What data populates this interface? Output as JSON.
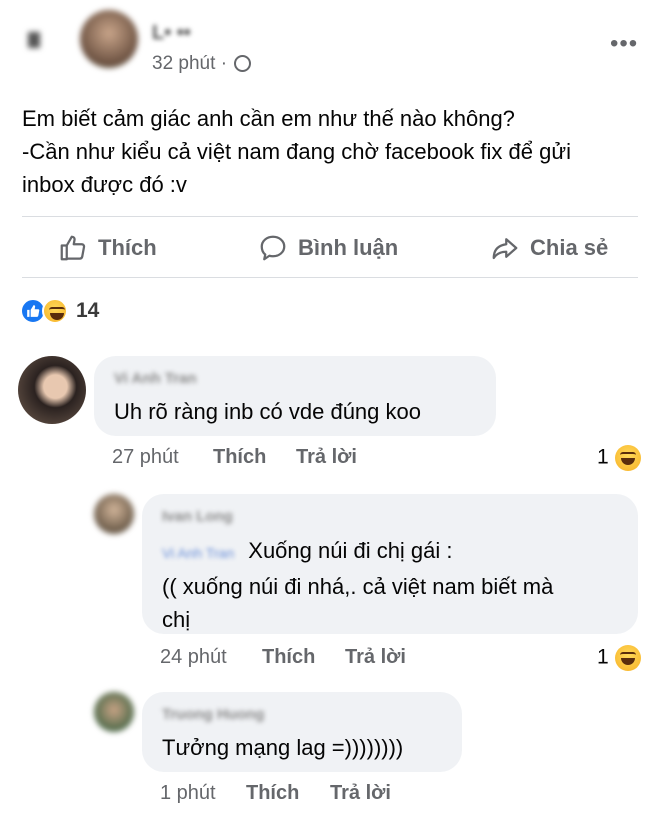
{
  "post": {
    "author_name": "L• ••",
    "time": "32 phút",
    "text_lines": [
      "Em biết cảm giác anh cần em như thế nào không?",
      "-Cần như kiểu cả việt nam đang chờ facebook fix để gửi",
      "inbox được đó :v"
    ]
  },
  "actions": {
    "like": "Thích",
    "comment": "Bình luận",
    "share": "Chia sẻ"
  },
  "reactions": {
    "count": "14"
  },
  "comments": [
    {
      "name": "Vi Anh Tran",
      "text": "Uh rõ ràng inb có vde đúng koo",
      "time": "27 phút",
      "like": "Thích",
      "reply": "Trả lời",
      "react_count": "1"
    },
    {
      "name": "Ivan Long",
      "mention": "Vi Anh Tran",
      "text_lines": [
        "Xuống núi đi chị gái :",
        "(( xuống núi đi nhá,. cả việt nam biết mà",
        "chị"
      ],
      "time": "24 phút",
      "like": "Thích",
      "reply": "Trả lời",
      "react_count": "1"
    },
    {
      "name": "Truong Huong",
      "text": "Tưởng mạng lag =))))))))",
      "time": "1 phút",
      "like": "Thích",
      "reply": "Trả lời"
    }
  ],
  "colors": {
    "like_blue": "#1877f2",
    "haha_yellow": "#f7b125"
  }
}
